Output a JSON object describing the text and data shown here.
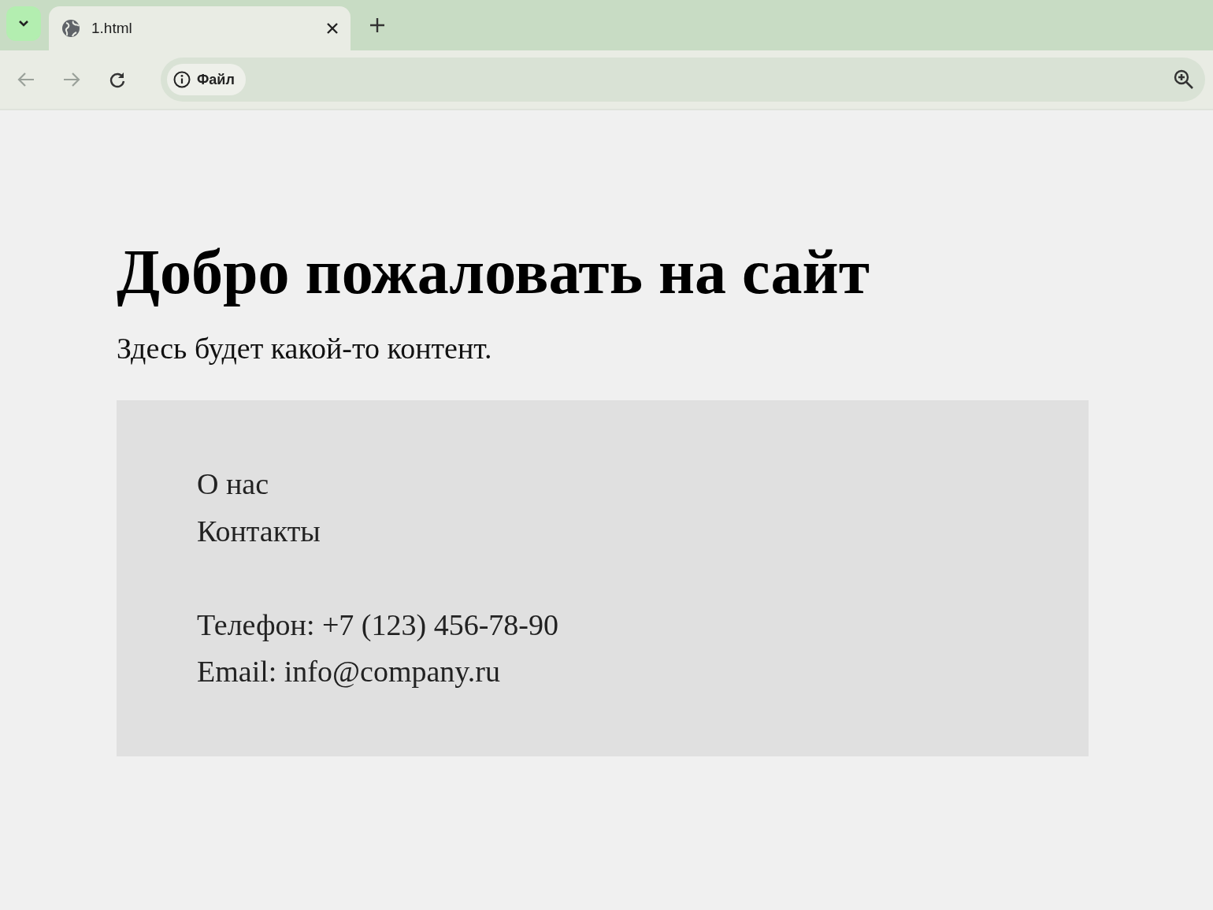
{
  "tabs": [
    {
      "title": "1.html",
      "selected": true
    }
  ],
  "address_bar": {
    "chip": "Файл"
  },
  "page": {
    "heading": "Добро пожаловать на сайт",
    "paragraph": "Здесь будет какой-то контент.",
    "footer": {
      "links": [
        "О нас",
        "Контакты"
      ],
      "contacts": [
        "Телефон: +7 (123) 456-78-90",
        "Email: info@company.ru"
      ]
    }
  }
}
